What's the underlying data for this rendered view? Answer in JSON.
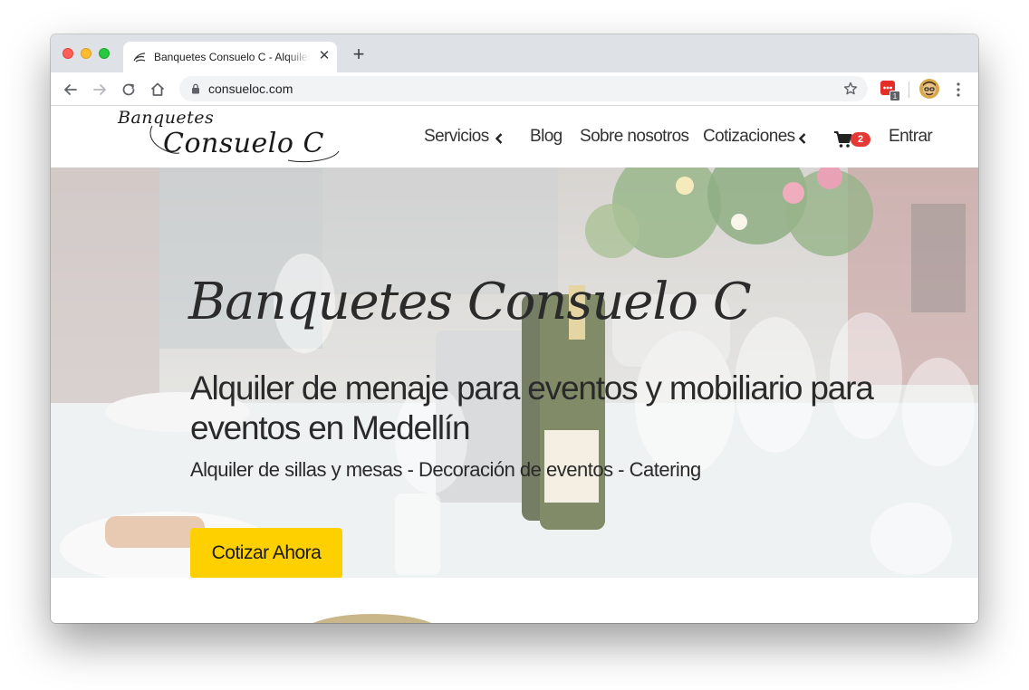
{
  "browser": {
    "tab_title": "Banquetes Consuelo C - Alquiler",
    "tab_close": "✕",
    "new_tab": "+",
    "url": "consueloc.com",
    "extension_badge": "1"
  },
  "site": {
    "logo_line1": "Banquetes",
    "logo_line2": "Consuelo C",
    "nav": {
      "servicios": "Servicios",
      "blog": "Blog",
      "sobre": "Sobre nosotros",
      "cotizaciones": "Cotizaciones",
      "cart_count": "2",
      "entrar": "Entrar"
    }
  },
  "hero": {
    "title": "Banquetes Consuelo C",
    "subtitle": "Alquiler de menaje para eventos y mobiliario para eventos en Medellín",
    "tagline": "Alquiler de sillas y mesas - Decoración de eventos - Catering",
    "cta": "Cotizar Ahora"
  },
  "colors": {
    "cta": "#ffd000",
    "cart_badge": "#e53935"
  }
}
